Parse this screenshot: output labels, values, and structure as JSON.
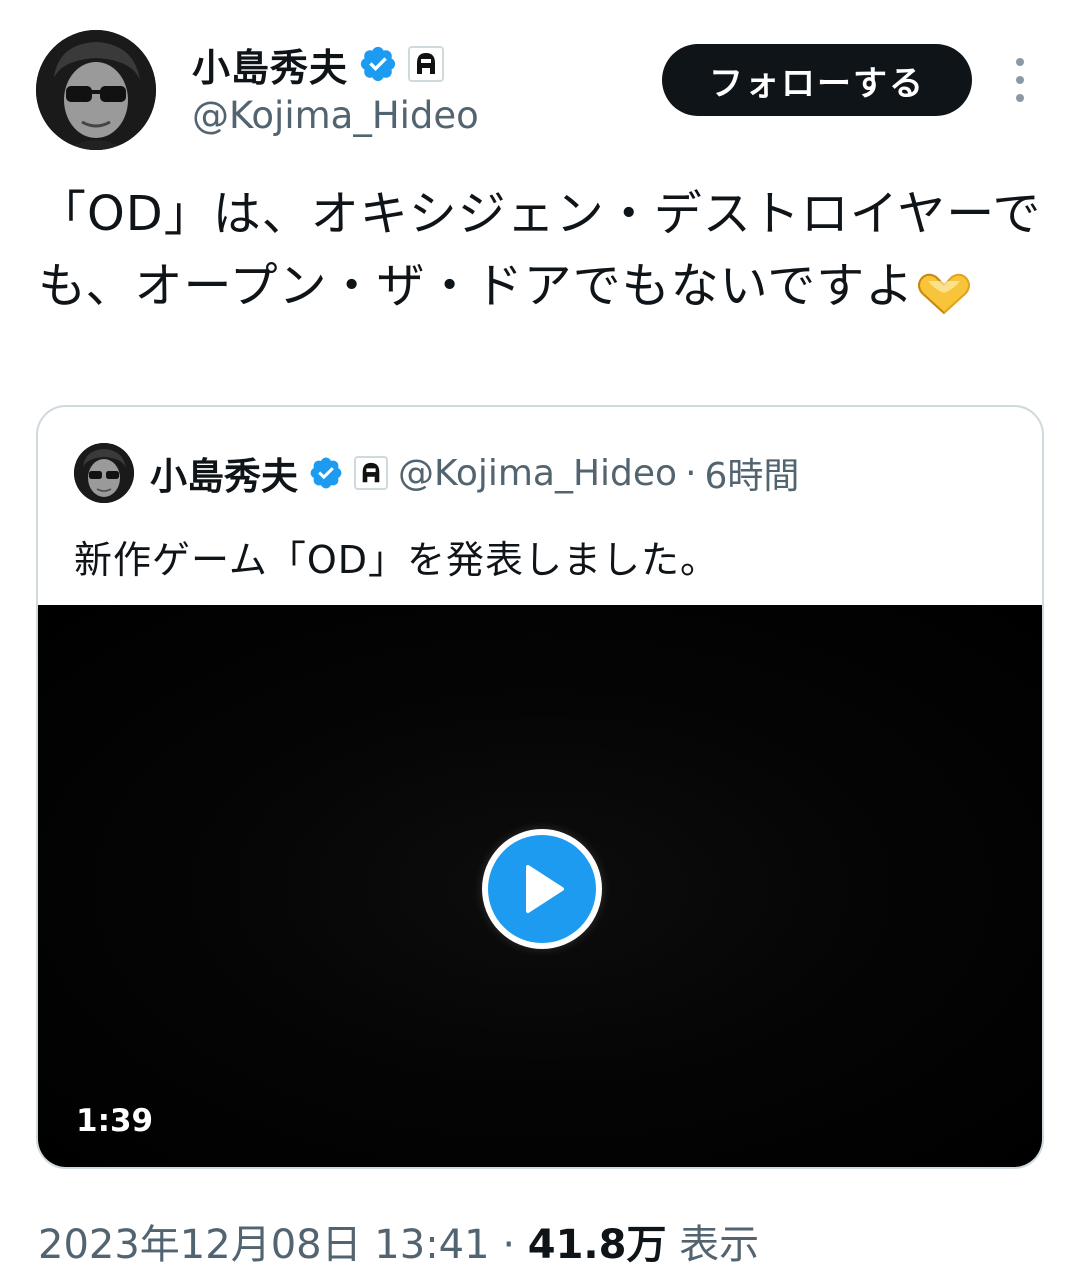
{
  "author": {
    "name": "小島秀夫",
    "handle": "@Kojima_Hideo",
    "verified_color": "#1d9bf0",
    "follow_label": "フォローする"
  },
  "tweet": {
    "text": "「OD」は、オキシジェン・デストロイヤーでも、オープン・ザ・ドアでもないですよ"
  },
  "quote": {
    "name": "小島秀夫",
    "handle": "@Kojima_Hideo",
    "separator": "·",
    "time": "6時間",
    "text": "新作ゲーム「OD」を発表しました。",
    "video": {
      "duration": "1:39"
    }
  },
  "meta": {
    "datetime": "2023年12月08日 13:41",
    "separator": "·",
    "views_count": "41.8万",
    "views_label": "表示"
  }
}
